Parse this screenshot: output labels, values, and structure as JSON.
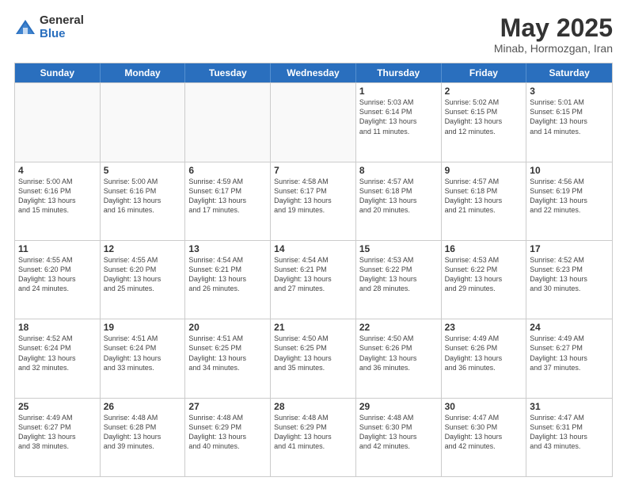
{
  "logo": {
    "general": "General",
    "blue": "Blue"
  },
  "title": "May 2025",
  "subtitle": "Minab, Hormozgan, Iran",
  "headers": [
    "Sunday",
    "Monday",
    "Tuesday",
    "Wednesday",
    "Thursday",
    "Friday",
    "Saturday"
  ],
  "rows": [
    [
      {
        "day": "",
        "info": ""
      },
      {
        "day": "",
        "info": ""
      },
      {
        "day": "",
        "info": ""
      },
      {
        "day": "",
        "info": ""
      },
      {
        "day": "1",
        "info": "Sunrise: 5:03 AM\nSunset: 6:14 PM\nDaylight: 13 hours\nand 11 minutes."
      },
      {
        "day": "2",
        "info": "Sunrise: 5:02 AM\nSunset: 6:15 PM\nDaylight: 13 hours\nand 12 minutes."
      },
      {
        "day": "3",
        "info": "Sunrise: 5:01 AM\nSunset: 6:15 PM\nDaylight: 13 hours\nand 14 minutes."
      }
    ],
    [
      {
        "day": "4",
        "info": "Sunrise: 5:00 AM\nSunset: 6:16 PM\nDaylight: 13 hours\nand 15 minutes."
      },
      {
        "day": "5",
        "info": "Sunrise: 5:00 AM\nSunset: 6:16 PM\nDaylight: 13 hours\nand 16 minutes."
      },
      {
        "day": "6",
        "info": "Sunrise: 4:59 AM\nSunset: 6:17 PM\nDaylight: 13 hours\nand 17 minutes."
      },
      {
        "day": "7",
        "info": "Sunrise: 4:58 AM\nSunset: 6:17 PM\nDaylight: 13 hours\nand 19 minutes."
      },
      {
        "day": "8",
        "info": "Sunrise: 4:57 AM\nSunset: 6:18 PM\nDaylight: 13 hours\nand 20 minutes."
      },
      {
        "day": "9",
        "info": "Sunrise: 4:57 AM\nSunset: 6:18 PM\nDaylight: 13 hours\nand 21 minutes."
      },
      {
        "day": "10",
        "info": "Sunrise: 4:56 AM\nSunset: 6:19 PM\nDaylight: 13 hours\nand 22 minutes."
      }
    ],
    [
      {
        "day": "11",
        "info": "Sunrise: 4:55 AM\nSunset: 6:20 PM\nDaylight: 13 hours\nand 24 minutes."
      },
      {
        "day": "12",
        "info": "Sunrise: 4:55 AM\nSunset: 6:20 PM\nDaylight: 13 hours\nand 25 minutes."
      },
      {
        "day": "13",
        "info": "Sunrise: 4:54 AM\nSunset: 6:21 PM\nDaylight: 13 hours\nand 26 minutes."
      },
      {
        "day": "14",
        "info": "Sunrise: 4:54 AM\nSunset: 6:21 PM\nDaylight: 13 hours\nand 27 minutes."
      },
      {
        "day": "15",
        "info": "Sunrise: 4:53 AM\nSunset: 6:22 PM\nDaylight: 13 hours\nand 28 minutes."
      },
      {
        "day": "16",
        "info": "Sunrise: 4:53 AM\nSunset: 6:22 PM\nDaylight: 13 hours\nand 29 minutes."
      },
      {
        "day": "17",
        "info": "Sunrise: 4:52 AM\nSunset: 6:23 PM\nDaylight: 13 hours\nand 30 minutes."
      }
    ],
    [
      {
        "day": "18",
        "info": "Sunrise: 4:52 AM\nSunset: 6:24 PM\nDaylight: 13 hours\nand 32 minutes."
      },
      {
        "day": "19",
        "info": "Sunrise: 4:51 AM\nSunset: 6:24 PM\nDaylight: 13 hours\nand 33 minutes."
      },
      {
        "day": "20",
        "info": "Sunrise: 4:51 AM\nSunset: 6:25 PM\nDaylight: 13 hours\nand 34 minutes."
      },
      {
        "day": "21",
        "info": "Sunrise: 4:50 AM\nSunset: 6:25 PM\nDaylight: 13 hours\nand 35 minutes."
      },
      {
        "day": "22",
        "info": "Sunrise: 4:50 AM\nSunset: 6:26 PM\nDaylight: 13 hours\nand 36 minutes."
      },
      {
        "day": "23",
        "info": "Sunrise: 4:49 AM\nSunset: 6:26 PM\nDaylight: 13 hours\nand 36 minutes."
      },
      {
        "day": "24",
        "info": "Sunrise: 4:49 AM\nSunset: 6:27 PM\nDaylight: 13 hours\nand 37 minutes."
      }
    ],
    [
      {
        "day": "25",
        "info": "Sunrise: 4:49 AM\nSunset: 6:27 PM\nDaylight: 13 hours\nand 38 minutes."
      },
      {
        "day": "26",
        "info": "Sunrise: 4:48 AM\nSunset: 6:28 PM\nDaylight: 13 hours\nand 39 minutes."
      },
      {
        "day": "27",
        "info": "Sunrise: 4:48 AM\nSunset: 6:29 PM\nDaylight: 13 hours\nand 40 minutes."
      },
      {
        "day": "28",
        "info": "Sunrise: 4:48 AM\nSunset: 6:29 PM\nDaylight: 13 hours\nand 41 minutes."
      },
      {
        "day": "29",
        "info": "Sunrise: 4:48 AM\nSunset: 6:30 PM\nDaylight: 13 hours\nand 42 minutes."
      },
      {
        "day": "30",
        "info": "Sunrise: 4:47 AM\nSunset: 6:30 PM\nDaylight: 13 hours\nand 42 minutes."
      },
      {
        "day": "31",
        "info": "Sunrise: 4:47 AM\nSunset: 6:31 PM\nDaylight: 13 hours\nand 43 minutes."
      }
    ]
  ]
}
